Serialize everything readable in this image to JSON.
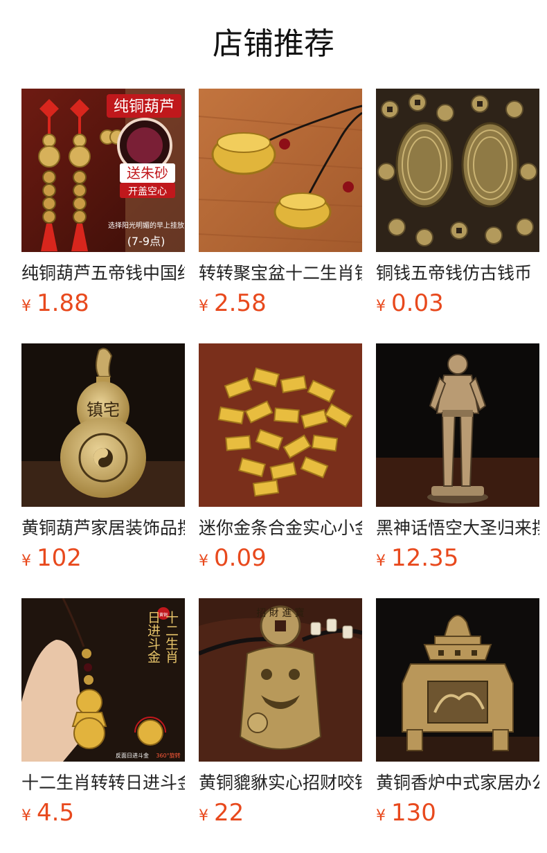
{
  "page": {
    "title": "店铺推荐"
  },
  "products": [
    {
      "name": "纯铜葫芦五帝钱中国结",
      "currency": "¥",
      "price": "1.88",
      "image": {
        "badge": "纯铜葫芦",
        "tag1": "送朱砂",
        "tag2": "开盖空心",
        "caption": "选择阳光明媚的早上挂放",
        "caption2": "(7-9点)"
      }
    },
    {
      "name": "转转聚宝盆十二生肖钥匙扣",
      "currency": "¥",
      "price": "2.58"
    },
    {
      "name": "铜钱五帝钱仿古钱币",
      "currency": "¥",
      "price": "0.03"
    },
    {
      "name": "黄铜葫芦家居装饰品摆件",
      "currency": "¥",
      "price": "102",
      "image": {
        "engraving": "镇宅"
      }
    },
    {
      "name": "迷你金条合金实心小金砖",
      "currency": "¥",
      "price": "0.09"
    },
    {
      "name": "黑神话悟空大圣归来摆件",
      "currency": "¥",
      "price": "12.35"
    },
    {
      "name": "十二生肖转转日进斗金挂件",
      "currency": "¥",
      "price": "4.5",
      "image": {
        "seal": "黄铜",
        "col1": "十二生肖",
        "col2": "日进斗金",
        "caption": "反面日进斗金",
        "caption_accent": "360°旋转"
      }
    },
    {
      "name": "黄铜貔貅实心招财咬钱摆件",
      "currency": "¥",
      "price": "22",
      "image": {
        "coin": "招 財 進 寶"
      }
    },
    {
      "name": "黄铜香炉中式家居办公室摆件",
      "currency": "¥",
      "price": "130"
    }
  ],
  "icons": [
    "product-photo-gourd-icon",
    "treasure-bowl-keychain-icon",
    "coins-icon",
    "brass-gourd-icon",
    "gold-bars-icon",
    "wukong-statue-icon",
    "zodiac-pendant-icon",
    "pixiu-icon",
    "incense-burner-icon"
  ],
  "colors": {
    "price": "#e8491d",
    "title": "#111111",
    "text": "#222222",
    "background": "#ffffff"
  }
}
